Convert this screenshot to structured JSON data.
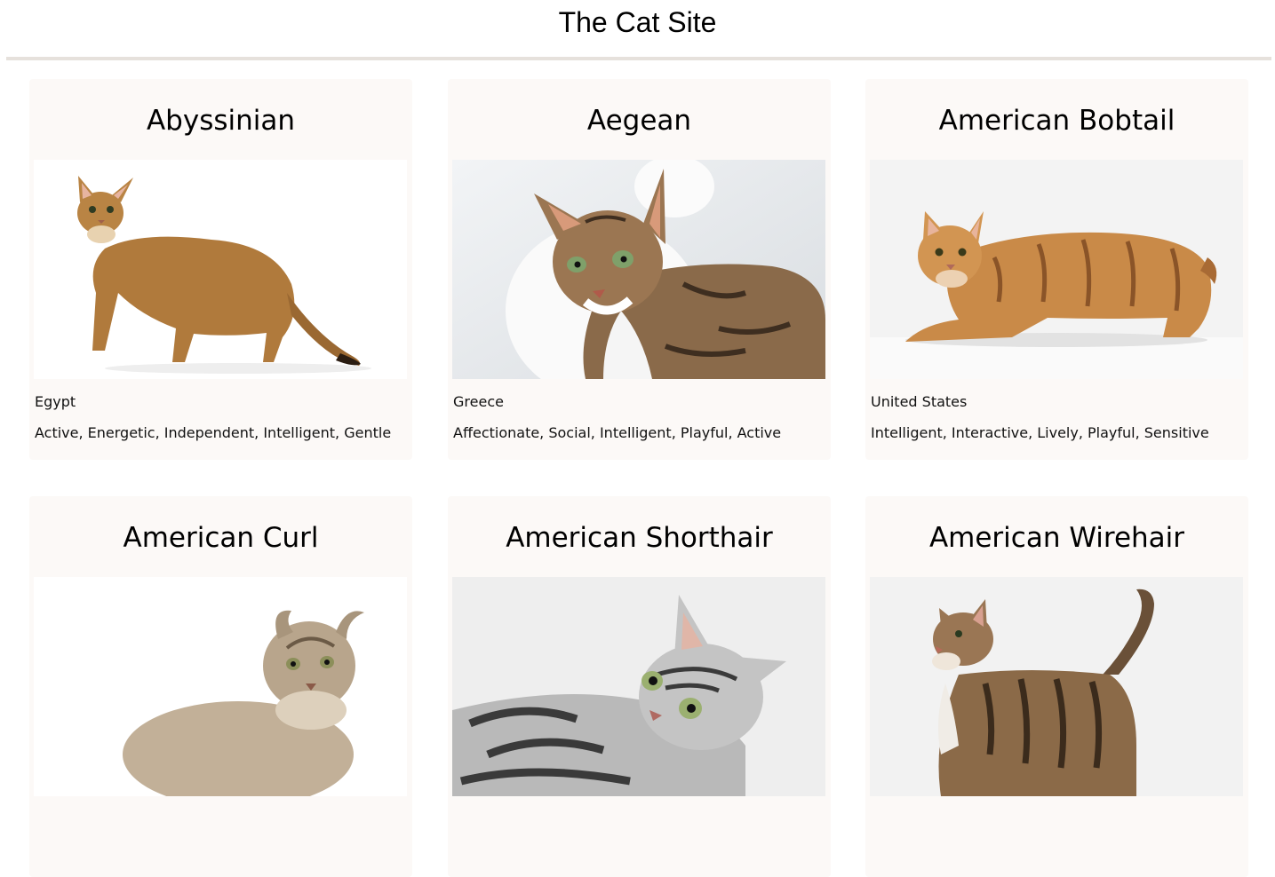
{
  "site": {
    "title": "The Cat Site"
  },
  "breeds": [
    {
      "name": "Abyssinian",
      "origin": "Egypt",
      "traits": "Active, Energetic, Independent, Intelligent, Gentle",
      "image": {
        "alt": "cat-photo",
        "bg": "#ffffff",
        "fur": "#b07a3c",
        "fur_dark": "#7a4a22",
        "pose": "walking"
      }
    },
    {
      "name": "Aegean",
      "origin": "Greece",
      "traits": "Affectionate, Social, Intelligent, Playful, Active",
      "image": {
        "alt": "cat-photo",
        "bg": "#e9ecef",
        "fur": "#8a6a4a",
        "fur_dark": "#3e2e20",
        "pose": "closeup"
      }
    },
    {
      "name": "American Bobtail",
      "origin": "United States",
      "traits": "Intelligent, Interactive, Lively, Playful, Sensitive",
      "image": {
        "alt": "cat-photo",
        "bg": "#f3f3f3",
        "fur": "#c98a48",
        "fur_dark": "#8a5428",
        "pose": "crouching"
      }
    },
    {
      "name": "American Curl",
      "origin": "",
      "traits": "",
      "image": {
        "alt": "cat-photo",
        "bg": "#ffffff",
        "fur": "#b8a58c",
        "fur_dark": "#6b5a46",
        "pose": "fluffy"
      }
    },
    {
      "name": "American Shorthair",
      "origin": "",
      "traits": "",
      "image": {
        "alt": "cat-photo",
        "bg": "#eeeeee",
        "fur": "#b9b9b9",
        "fur_dark": "#3a3a3a",
        "pose": "lying"
      }
    },
    {
      "name": "American Wirehair",
      "origin": "",
      "traits": "",
      "image": {
        "alt": "cat-photo",
        "bg": "#f2f2f2",
        "fur": "#8b6a48",
        "fur_dark": "#3b2b1c",
        "pose": "standing"
      }
    }
  ]
}
